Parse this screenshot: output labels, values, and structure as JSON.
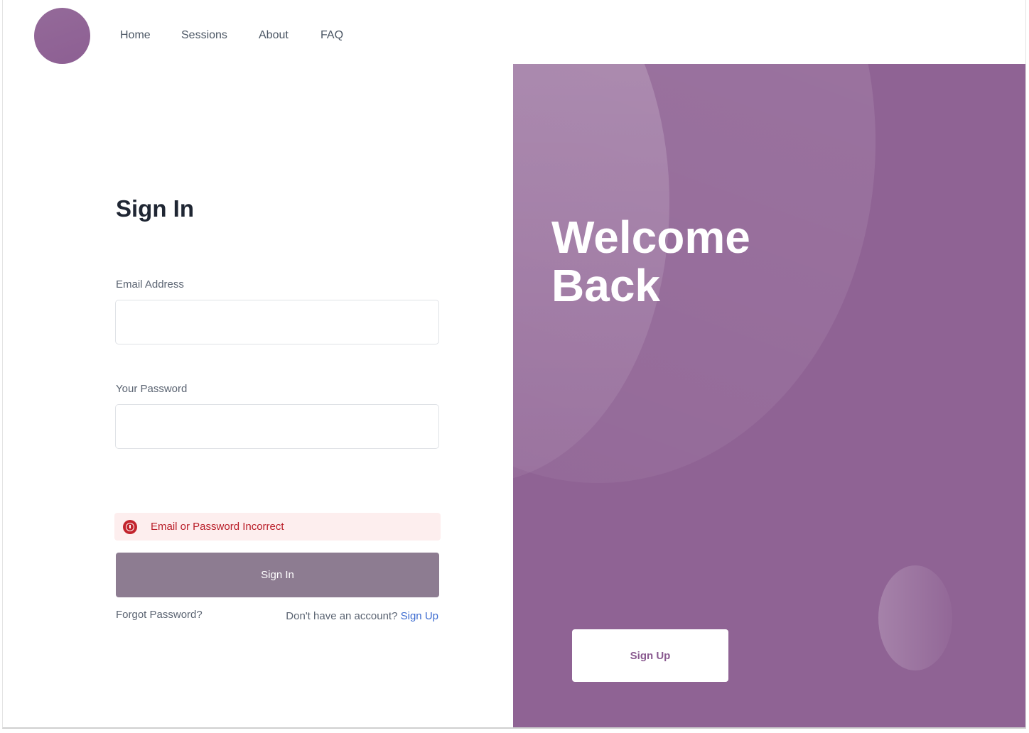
{
  "header": {
    "nav": [
      "Home",
      "Sessions",
      "About",
      "FAQ"
    ]
  },
  "form": {
    "title": "Sign In",
    "email_label": "Email Address",
    "email_value": "",
    "password_label": "Your Password",
    "password_value": "",
    "error_message": "Email or Password Incorrect",
    "submit_label": "Sign In",
    "forgot_label": "Forgot Password?",
    "no_account_prompt": "Don't have an account?",
    "signup_link_label": "Sign Up"
  },
  "hero": {
    "title_line1": "Welcome",
    "title_line2": "Back",
    "signup_button_label": "Sign Up"
  },
  "colors": {
    "brand_purple": "#8f6394",
    "button_muted": "#8d7c91",
    "error_red": "#b91d28",
    "link_blue": "#3c6bd0"
  }
}
